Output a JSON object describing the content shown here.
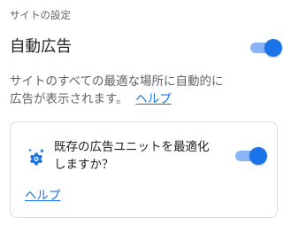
{
  "section_label": "サイトの設定",
  "title": "自動広告",
  "description": {
    "line1": "サイトのすべての最適な場所に自動的に",
    "line2": "広告が表示されます。",
    "help_label": "ヘルプ"
  },
  "card": {
    "text_line1": "既存の広告ユニットを最適化",
    "text_line2": "しますか？",
    "help_label": "ヘルプ",
    "icon": "gear-sparkle-icon"
  },
  "toggles": {
    "auto_ads_enabled": true,
    "optimize_units_enabled": true
  },
  "colors": {
    "accent": "#1a73e8",
    "track": "#8ab4f8",
    "text_secondary": "#5f6368",
    "border": "#dadce0"
  }
}
